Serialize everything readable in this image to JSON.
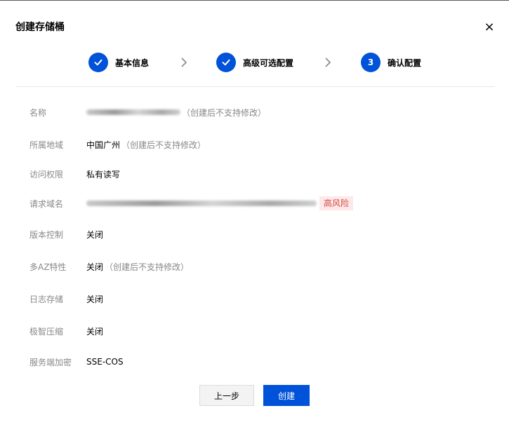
{
  "dialog": {
    "title": "创建存储桶",
    "close_label": "×"
  },
  "steps": [
    {
      "label": "基本信息",
      "status": "done"
    },
    {
      "label": "高级可选配置",
      "status": "done"
    },
    {
      "label": "确认配置",
      "status": "current",
      "number": "3"
    }
  ],
  "fields": {
    "name": {
      "label": "名称",
      "note": "（创建后不支持修改）"
    },
    "region": {
      "label": "所属地域",
      "value": "中国广州",
      "note": "（创建后不支持修改）"
    },
    "access": {
      "label": "访问权限",
      "value": "私有读写"
    },
    "domain": {
      "label": "请求域名",
      "tag": "高风险"
    },
    "versioning": {
      "label": "版本控制",
      "value": "关闭"
    },
    "multi_az": {
      "label": "多AZ特性",
      "value": "关闭",
      "note": "（创建后不支持修改）"
    },
    "logging": {
      "label": "日志存储",
      "value": "关闭"
    },
    "compression": {
      "label": "极智压缩",
      "value": "关闭"
    },
    "encryption": {
      "label": "服务端加密",
      "value": "SSE-COS"
    }
  },
  "buttons": {
    "prev": "上一步",
    "create": "创建"
  },
  "colors": {
    "primary": "#0052d9",
    "risk_text": "#d54941",
    "risk_bg": "#fde9ea"
  }
}
